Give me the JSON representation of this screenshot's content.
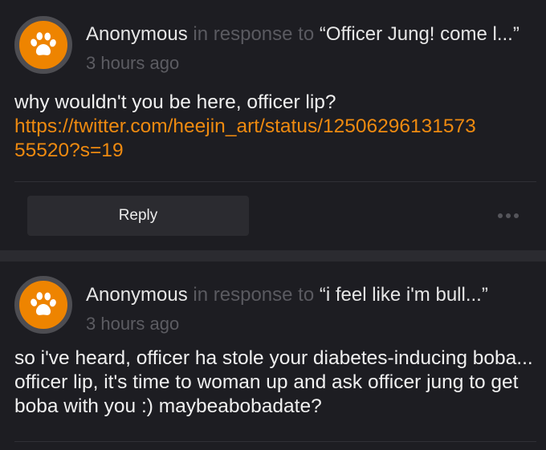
{
  "comments": [
    {
      "author": "Anonymous",
      "in_response_to": "in response to",
      "quote": "“Officer Jung! come l...”",
      "time": "3 hours ago",
      "text": "why wouldn't you be here, officer lip?",
      "link_line1": "https://twitter.com/heejin_art/status/12506296131573",
      "link_line2": "55520?s=19",
      "reply_label": "Reply"
    },
    {
      "author": "Anonymous",
      "in_response_to": "in response to",
      "quote": "“i feel like i'm bull...”",
      "time": "3 hours ago",
      "text": "so i've heard, officer ha stole your diabetes-inducing boba... officer lip, it's time to woman up and ask officer jung to get boba with you :) maybeabobadate?"
    }
  ],
  "colors": {
    "accent": "#ee8400",
    "background": "#1d1d22",
    "link": "#ee8a10"
  },
  "icons": {
    "avatar": "paw-icon",
    "more": "more-horizontal-icon"
  }
}
